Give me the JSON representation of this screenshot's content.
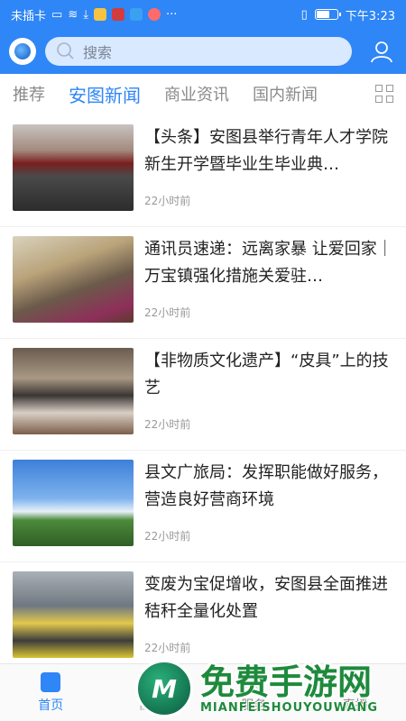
{
  "status_bar": {
    "carrier": "未插卡",
    "time": "下午3:23"
  },
  "header": {
    "search_placeholder": "搜索"
  },
  "tabs": [
    {
      "label": "推荐"
    },
    {
      "label": "安图新闻"
    },
    {
      "label": "商业资讯"
    },
    {
      "label": "国内新闻"
    }
  ],
  "news": [
    {
      "title": "【头条】安图县举行青年人才学院新生开学暨毕业生毕业典…",
      "time": "22小时前"
    },
    {
      "title": "通讯员速递：远离家暴 让爱回家｜ 万宝镇强化措施关爱驻…",
      "time": "22小时前"
    },
    {
      "title": "【非物质文化遗产】“皮具”上的技艺",
      "time": "22小时前"
    },
    {
      "title": "县文广旅局：发挥职能做好服务，营造良好营商环境",
      "time": "22小时前"
    },
    {
      "title": "变废为宝促增收，安图县全面推进秸秆全量化处置",
      "time": "22小时前"
    }
  ],
  "bottom_nav": [
    {
      "label": "首页"
    },
    {
      "label": "融媒"
    },
    {
      "label": "服务"
    },
    {
      "label": "直播"
    }
  ],
  "watermark": {
    "cn": "免费手游网",
    "en": "MIANFEISHOUYOUWANG",
    "mark": "M"
  },
  "colors": {
    "brand_blue": "#2f86f6",
    "watermark_green": "#1e8a3c"
  }
}
